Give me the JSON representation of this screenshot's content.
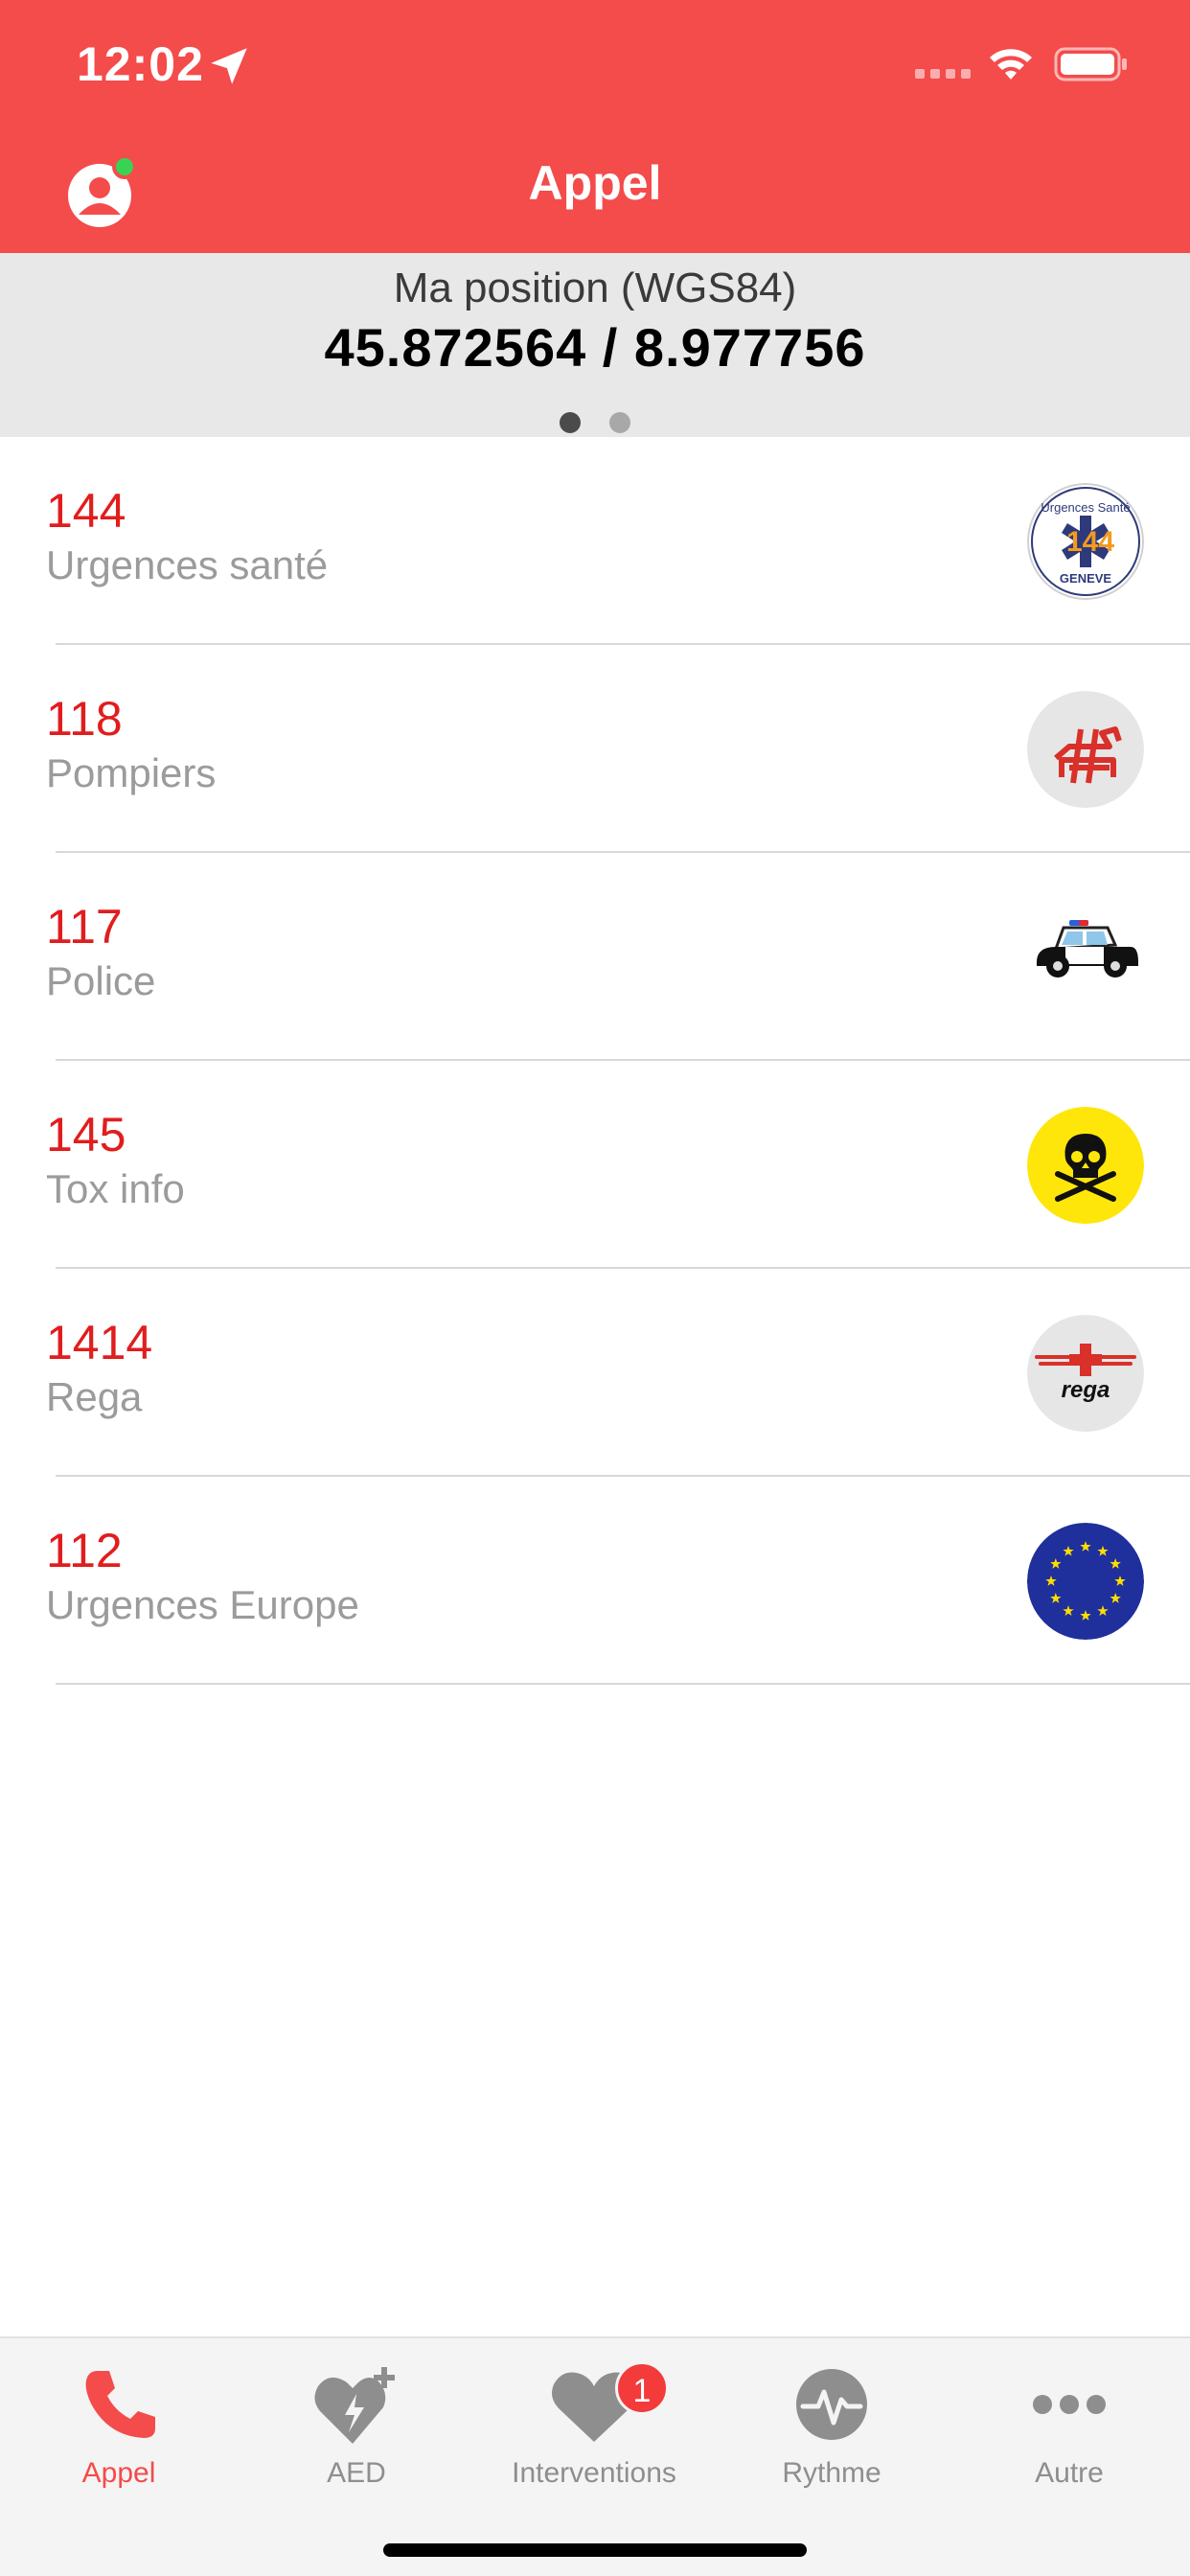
{
  "status_bar": {
    "time": "12:02"
  },
  "header": {
    "title": "Appel"
  },
  "position": {
    "label": "Ma position (WGS84)",
    "coordinates": "45.872564 / 8.977756",
    "page_index": 1,
    "page_count": 2
  },
  "contacts": [
    {
      "number": "144",
      "name": "Urgences santé",
      "icon": "urgences-sante-geneve-logo",
      "logo_text_top": "Urgences Santé",
      "logo_text_mid": "144",
      "logo_text_bottom": "GENEVE"
    },
    {
      "number": "118",
      "name": "Pompiers",
      "icon": "pompiers-logo"
    },
    {
      "number": "117",
      "name": "Police",
      "icon": "police-car-icon"
    },
    {
      "number": "145",
      "name": "Tox info",
      "icon": "skull-crossbones-icon"
    },
    {
      "number": "1414",
      "name": "Rega",
      "icon": "rega-logo",
      "logo_text": "rega"
    },
    {
      "number": "112",
      "name": "Urgences Europe",
      "icon": "eu-flag-icon"
    }
  ],
  "tabs": [
    {
      "label": "Appel",
      "icon": "phone-icon",
      "active": true
    },
    {
      "label": "AED",
      "icon": "aed-heart-icon",
      "active": false
    },
    {
      "label": "Interventions",
      "icon": "heart-icon",
      "active": false,
      "badge": "1"
    },
    {
      "label": "Rythme",
      "icon": "heartbeat-icon",
      "active": false
    },
    {
      "label": "Autre",
      "icon": "more-icon",
      "active": false
    }
  ],
  "colors": {
    "brand_red": "#f44b4b",
    "number_red": "#e11d1d",
    "label_gray": "#9b9b9b",
    "banner_gray": "#e8e8e8"
  }
}
